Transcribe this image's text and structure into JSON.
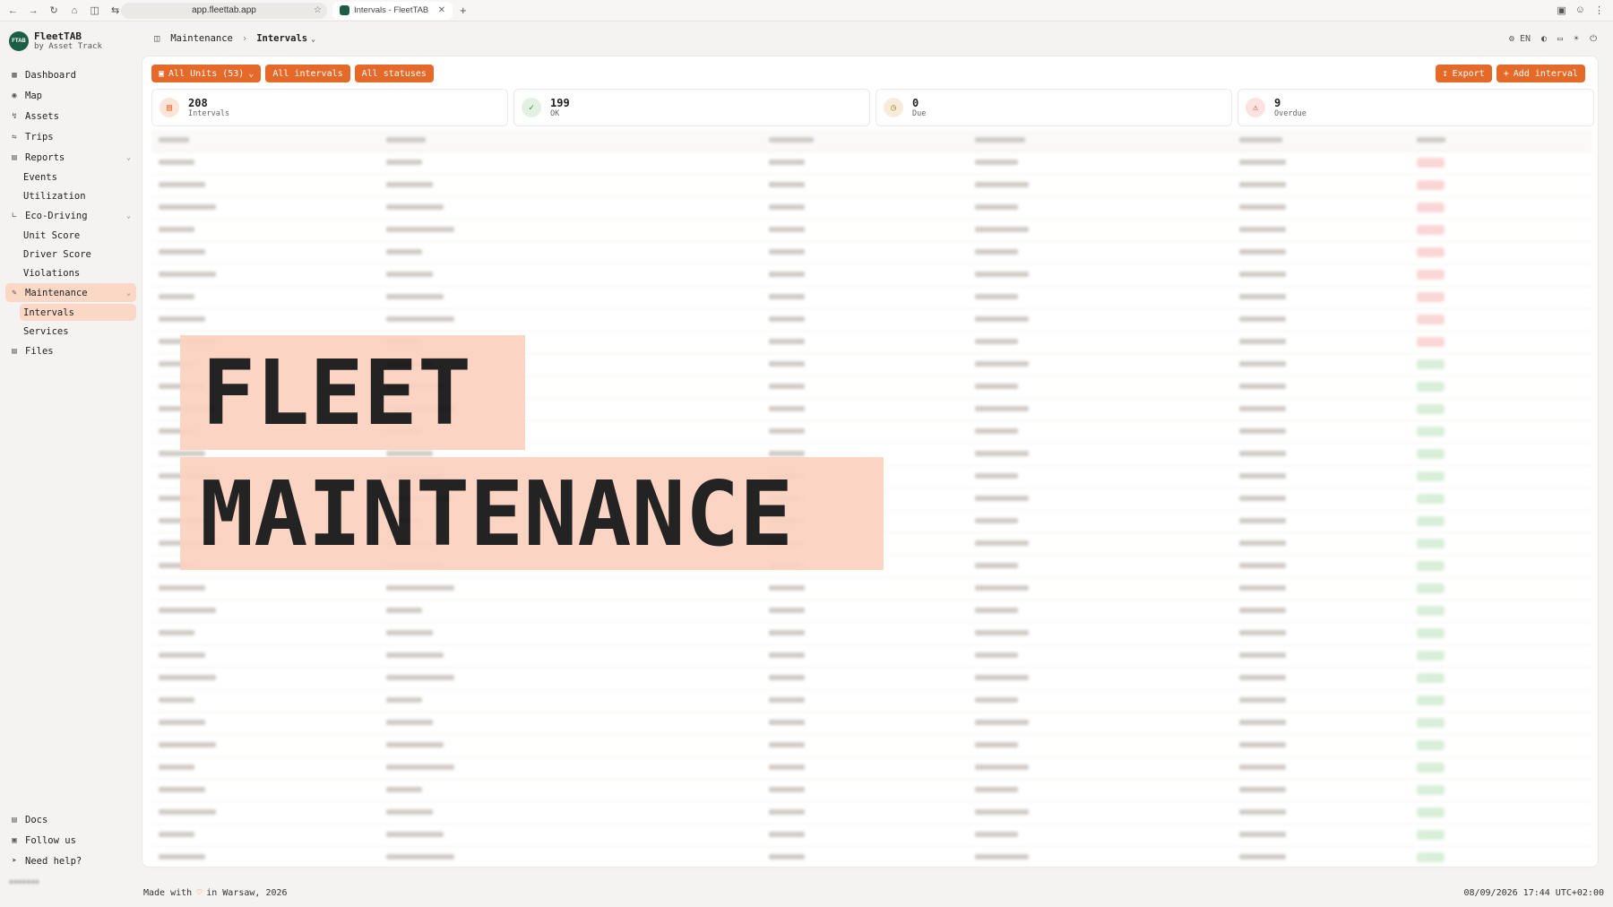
{
  "browser": {
    "url": "app.fleettab.app",
    "tab_title": "Intervals - FleetTAB"
  },
  "brand": {
    "name": "FleetTAB",
    "sub": "by Asset Track",
    "logo_text": "FTAB"
  },
  "sidebar": {
    "items": [
      {
        "label": "Dashboard"
      },
      {
        "label": "Map"
      },
      {
        "label": "Assets"
      },
      {
        "label": "Trips"
      },
      {
        "label": "Reports"
      },
      {
        "label": "Events"
      },
      {
        "label": "Utilization"
      },
      {
        "label": "Eco-Driving"
      },
      {
        "label": "Unit Score"
      },
      {
        "label": "Driver Score"
      },
      {
        "label": "Violations"
      },
      {
        "label": "Maintenance"
      },
      {
        "label": "Intervals"
      },
      {
        "label": "Services"
      },
      {
        "label": "Files"
      }
    ],
    "bottom": [
      {
        "label": "Docs"
      },
      {
        "label": "Follow us"
      },
      {
        "label": "Need help?"
      }
    ]
  },
  "breadcrumb": {
    "parent": "Maintenance",
    "current": "Intervals"
  },
  "toolbar": {
    "lang": "EN"
  },
  "filters": {
    "units": "All Units (53)",
    "intervals": "All intervals",
    "statuses": "All statuses"
  },
  "actions": {
    "export": "Export",
    "add": "Add interval"
  },
  "stats": [
    {
      "value": "208",
      "label": "Intervals"
    },
    {
      "value": "199",
      "label": "OK"
    },
    {
      "value": "0",
      "label": "Due"
    },
    {
      "value": "9",
      "label": "Overdue"
    }
  ],
  "overlay": {
    "line1": "FLEET",
    "line2": "MAINTENANCE"
  },
  "footer": {
    "made_prefix": "Made with",
    "made_suffix": "in Warsaw, 2026",
    "timestamp": "08/09/2026 17:44 UTC+02:00"
  },
  "colors": {
    "accent": "#e56a2a",
    "brand": "#1b5e45",
    "active_bg": "#fbd8c6",
    "overlay_bg": "#fcd1c0"
  }
}
